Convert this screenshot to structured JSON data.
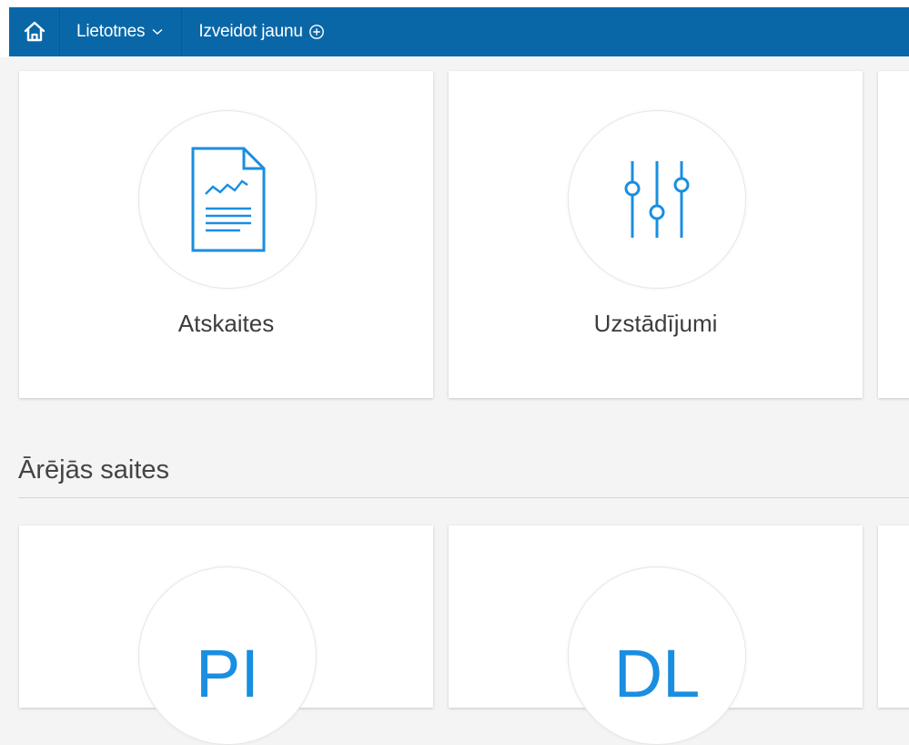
{
  "nav": {
    "home_icon": "home-icon",
    "apps_label": "Lietotnes",
    "create_label": "Izveidot jaunu"
  },
  "tiles": [
    {
      "label": "Atskaites",
      "icon": "report-document-icon"
    },
    {
      "label": "Uzstādījumi",
      "icon": "sliders-icon"
    }
  ],
  "external": {
    "title": "Ārējās saites",
    "tiles": [
      {
        "text": "PI"
      },
      {
        "text": "DL"
      }
    ]
  },
  "colors": {
    "navbar": "#0967a8",
    "icon_blue": "#1a8ee0",
    "background": "#f4f4f4"
  }
}
